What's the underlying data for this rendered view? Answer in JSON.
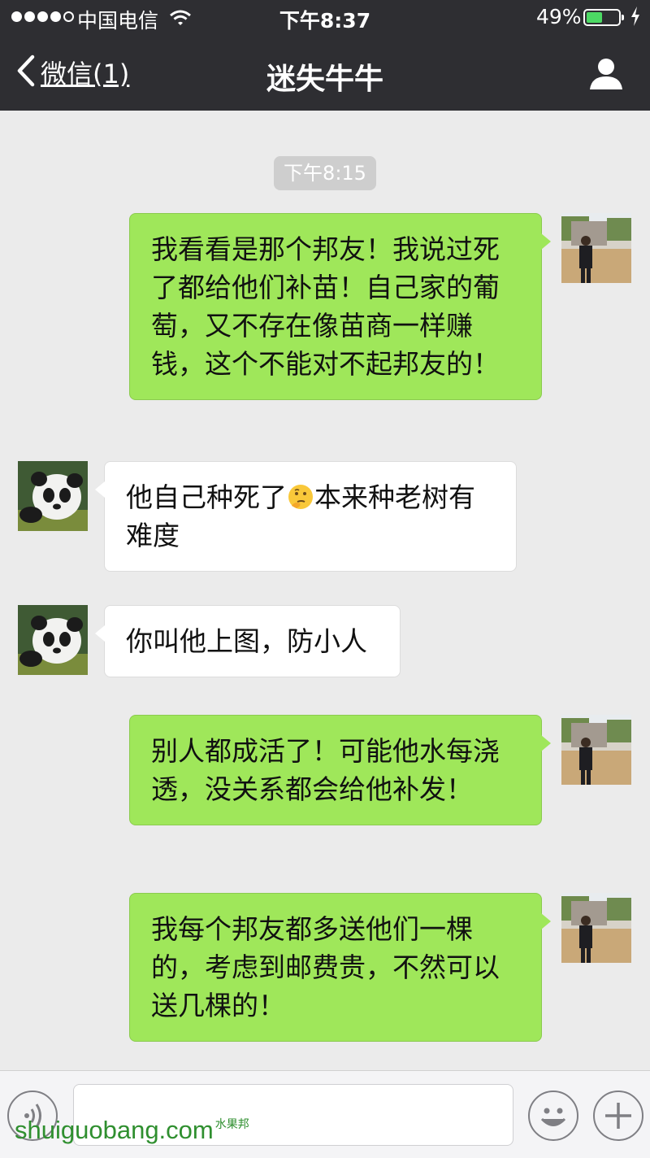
{
  "status_bar": {
    "carrier": "中国电信",
    "time": "下午8:37",
    "battery_percent": "49%",
    "battery_level": 0.49
  },
  "nav": {
    "back_label": "微信(1)",
    "title": "迷失牛牛"
  },
  "timestamp": "下午8:15",
  "messages": [
    {
      "side": "me",
      "text": "我看看是那个邦友！我说过死了都给他们补苗！自己家的葡萄，又不存在像苗商一样赚钱，这个不能对不起邦友的！"
    },
    {
      "side": "them",
      "text_before": "他自己种死了",
      "emoji": "thinking-face",
      "text_after": "本来种老树有难度"
    },
    {
      "side": "them",
      "text": "你叫他上图，防小人"
    },
    {
      "side": "me",
      "text": "别人都成活了！可能他水每浇透，没关系都会给他补发！"
    },
    {
      "side": "me",
      "text": "我每个邦友都多送他们一棵的，考虑到邮费贵，不然可以送几棵的！"
    }
  ],
  "watermark": {
    "main": "shuiguobang.com",
    "small": "水果邦"
  },
  "colors": {
    "nav_bg": "#2e2e32",
    "my_bubble": "#9fe75a",
    "their_bubble": "#ffffff",
    "chat_bg": "#ebebeb"
  }
}
